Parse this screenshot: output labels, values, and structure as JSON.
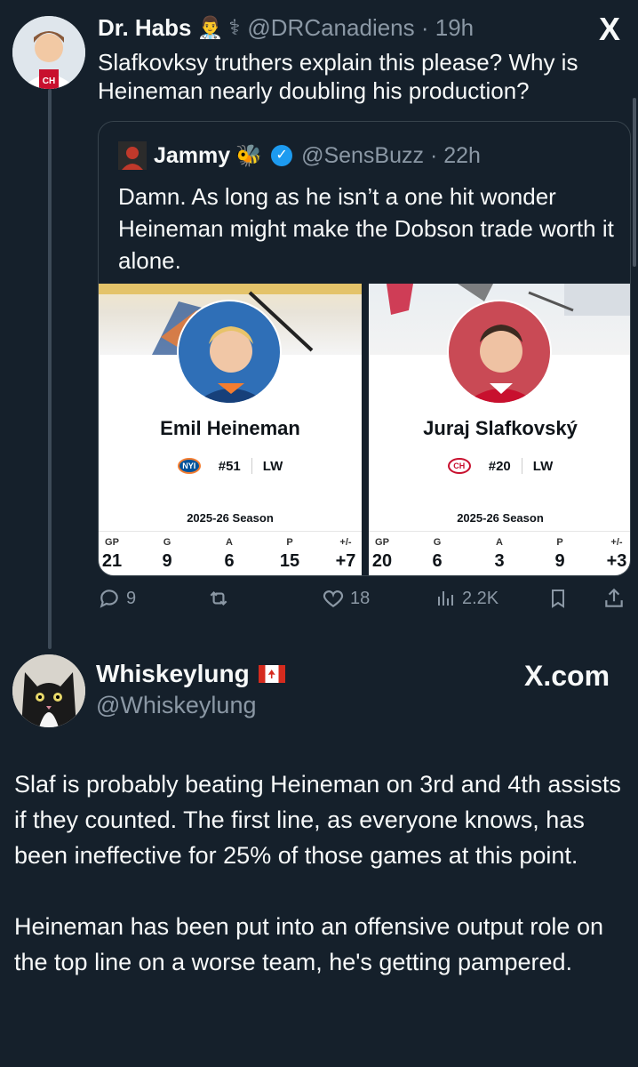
{
  "tweet1": {
    "display_name": "Dr. Habs",
    "emoji_1": "👨‍⚕️",
    "emoji_2": "⚕",
    "handle_meta": "@DRCanadiens · 19h",
    "text": "Slafkovksy truthers explain this please? Why is Heineman nearly doubling his production?",
    "close_icon": "X"
  },
  "quote": {
    "display_name": "Jammy",
    "emoji": "🐝",
    "verified_icon": "verified-badge-icon",
    "handle_meta": "@SensBuzz · 22h",
    "text": "Damn. As long as he isn’t a one hit wonder Heineman might make the Dobson trade worth it alone."
  },
  "cards": [
    {
      "name": "Emil Heineman",
      "team_logo": "NYI",
      "number": "#51",
      "position": "LW",
      "season": "2025-26 Season",
      "stat_labels": [
        "GP",
        "G",
        "A",
        "P",
        "+/-"
      ],
      "stat_values": [
        "21",
        "9",
        "6",
        "15",
        "+7"
      ]
    },
    {
      "name": "Juraj Slafkovský",
      "team_logo": "CH",
      "number": "#20",
      "position": "LW",
      "season": "2025-26 Season",
      "stat_labels": [
        "GP",
        "G",
        "A",
        "P",
        "+/-"
      ],
      "stat_values": [
        "20",
        "6",
        "3",
        "9",
        "+3"
      ]
    }
  ],
  "actions": {
    "replies": "9",
    "likes": "18",
    "views": "2.2K"
  },
  "tweet2": {
    "display_name": "Whiskeylung",
    "flag": "canada-flag",
    "handle": "@Whiskeylung",
    "source": "X.com",
    "paragraph_1": "Slaf is probably beating Heineman on 3rd and 4th assists if they counted. The first line, as everyone knows, has been ineffective for 25% of those games at this point.",
    "paragraph_2": "Heineman has been put into an offensive output role on the top line on a worse team, he's getting pampered."
  },
  "colors": {
    "background": "#15202b",
    "text": "#f7f9f9",
    "muted": "#8b98a5",
    "verified": "#1d9bf0",
    "border": "#38444d"
  }
}
